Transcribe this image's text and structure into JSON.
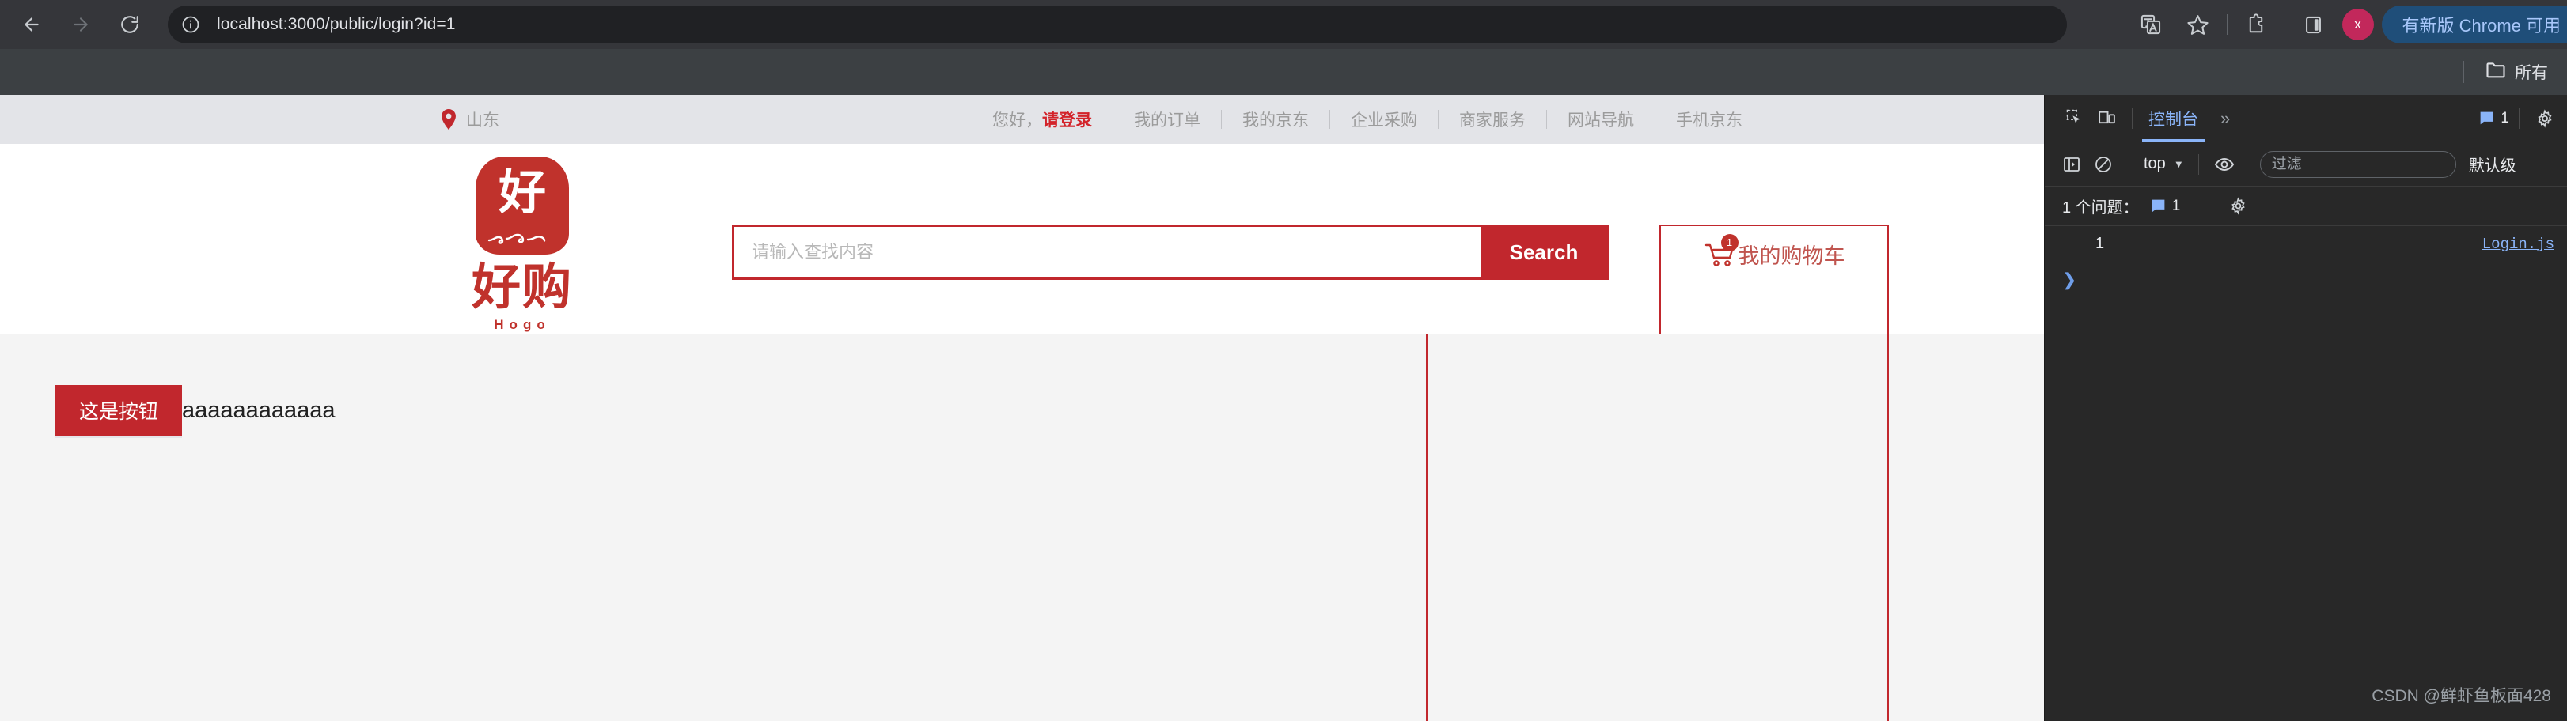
{
  "browser": {
    "back_label": "back-arrow",
    "forward_label": "forward-arrow",
    "reload_label": "reload",
    "site_info_label": "site-information",
    "url": "localhost:3000/public/login?id=1",
    "toolbar_icons": [
      "translate-icon",
      "bookmark-star-icon",
      "extensions-icon",
      "side-panel-icon"
    ],
    "profile_initial": "x",
    "update_pill": "有新版 Chrome 可用",
    "bookmark": {
      "folder_label": "所有"
    }
  },
  "site": {
    "topbar": {
      "location": "山东",
      "greeting_prefix": "您好，",
      "greeting_link": "请登录",
      "links": [
        "我的订单",
        "我的京东",
        "企业采购",
        "商家服务",
        "网站导航",
        "手机京东"
      ]
    },
    "logo": {
      "seal_char": "好",
      "wordmark": "好购",
      "subtitle": "Hogo"
    },
    "search": {
      "placeholder": "请输入查找内容",
      "value": "",
      "button_label": "Search"
    },
    "cart": {
      "label": "我的购物车",
      "badge": "1"
    },
    "body": {
      "button_label": "这是按钮",
      "text": "aaaaaaaaaaaa"
    },
    "colors": {
      "brand_red": "#c1272d",
      "logo_red": "#c0322c",
      "page_bg": "#f4f4f4",
      "topbar_bg": "#e3e4e8"
    }
  },
  "devtools": {
    "active_tab": "控制台",
    "more_tabs": "»",
    "issue_count": "1",
    "context": "top",
    "filter_placeholder": "过滤",
    "filter_value": "",
    "level_label": "默认级",
    "issues_text": "1 个问题：",
    "issues_count": "1",
    "console": {
      "log_value": "1",
      "log_source": "Login.js",
      "prompt": "❯"
    },
    "watermark": "CSDN @鲜虾鱼板面428"
  }
}
